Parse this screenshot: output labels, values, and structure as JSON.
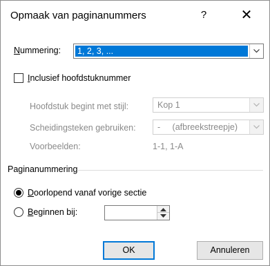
{
  "dialog": {
    "title": "Opmaak van paginanummers",
    "help_glyph": "?",
    "close_glyph": "✕"
  },
  "numbering": {
    "label_underlined": "N",
    "label_rest": "ummering:",
    "selected_value": "1, 2, 3, ..."
  },
  "include_chapter": {
    "label_underlined": "I",
    "label_rest": "nclusief hoofdstuknummer",
    "checked": false
  },
  "chapter": {
    "starts_with_style_label": "Hoofdstuk begint met stijl:",
    "starts_with_style_value": "Kop 1",
    "separator_label": "Scheidingsteken gebruiken:",
    "separator_value": "-     (afbreekstreepje)",
    "examples_label": "Voorbeelden:",
    "examples_value": "1-1, 1-A"
  },
  "page_numbering": {
    "group_title": "Paginanummering",
    "continue_underlined": "D",
    "continue_rest": "oorlopend vanaf vorige sectie",
    "continue_selected": true,
    "start_underlined": "B",
    "start_rest": "eginnen bij:",
    "start_selected": false,
    "start_value": ""
  },
  "buttons": {
    "ok_label": "OK",
    "cancel_label": "Annuleren"
  },
  "colors": {
    "accent": "#0078d7",
    "disabled_text": "#8a8a8a"
  }
}
